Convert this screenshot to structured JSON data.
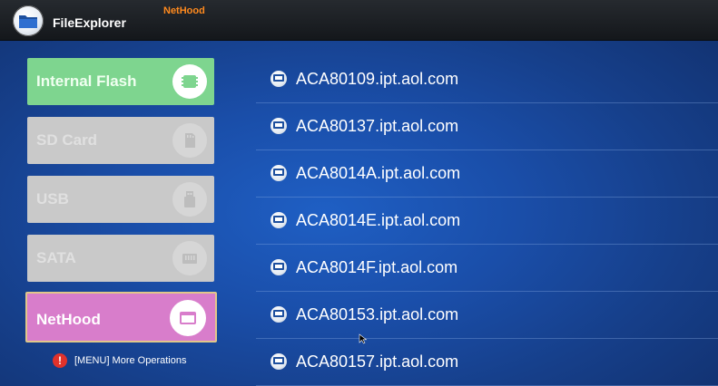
{
  "header": {
    "app_title": "FileExplorer",
    "location": "NetHood"
  },
  "sidebar": {
    "items": [
      {
        "label": "Internal Flash",
        "icon": "flash-chip-icon",
        "state": "enabled"
      },
      {
        "label": "SD Card",
        "icon": "sd-card-icon",
        "state": "disabled"
      },
      {
        "label": "USB",
        "icon": "usb-icon",
        "state": "disabled"
      },
      {
        "label": "SATA",
        "icon": "sata-icon",
        "state": "disabled"
      },
      {
        "label": "NetHood",
        "icon": "network-folder-icon",
        "state": "selected"
      }
    ],
    "hint": "[MENU] More Operations",
    "hint_icon": "!"
  },
  "hosts": [
    "ACA80109.ipt.aol.com",
    "ACA80137.ipt.aol.com",
    "ACA8014A.ipt.aol.com",
    "ACA8014E.ipt.aol.com",
    "ACA8014F.ipt.aol.com",
    "ACA80153.ipt.aol.com",
    "ACA80157.ipt.aol.com"
  ],
  "colors": {
    "accent_location": "#ff8a1e",
    "flash_button": "#7ed58f",
    "disabled_button": "#c9c9c9",
    "nethood_button": "#d87dcb",
    "background": "#1a4ea9"
  }
}
